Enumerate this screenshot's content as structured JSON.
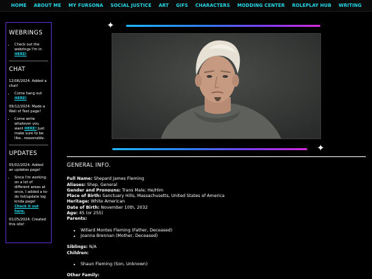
{
  "nav": [
    {
      "label": "HOME"
    },
    {
      "label": "ABOUT ME"
    },
    {
      "label": "MY FURSONA"
    },
    {
      "label": "SOCIAL JUSTICE"
    },
    {
      "label": "ART"
    },
    {
      "label": "GIFS"
    },
    {
      "label": "CHARACTERS"
    },
    {
      "label": "MODDING CENTER"
    },
    {
      "label": "ROLEPLAY HUB"
    },
    {
      "label": "WRITING"
    }
  ],
  "sidebar": {
    "webrings": {
      "title": "WEBRINGS",
      "item_text": "Check out the webrings I'm in",
      "item_link": "HERE!"
    },
    "chat": {
      "title": "CHAT",
      "entry1": "12/06/2024: Added a chat!",
      "item1_text": "Come hang out",
      "item1_link": "HERE!",
      "entry2": "09/12/2024: Made a Wall of Text page!",
      "item2_text": "Come write whatever you want",
      "item2_link": "HERE!",
      "item2_after": "Just make sure to be like.. reasonable."
    },
    "updates": {
      "title": "UPDATES",
      "entry1": "05/02/2024: Added an updates page!",
      "item_text": "Since I'm working on a lot of different areas at once, I added a to-do list/update log kinda page!",
      "item_link": "Check it out here.",
      "entry2": "01/25/2024: Created this site!"
    }
  },
  "colors": {
    "accent": "#27d7e6",
    "sidebar_border": "#5a2fd0",
    "gradient_start": "#1fb6ff",
    "gradient_end": "#d22bd6"
  },
  "info": {
    "heading": "GENERAL INFO.",
    "full_name_label": "Full Name:",
    "full_name": "Shepard James Fleming",
    "aliases_label": "Aliases:",
    "aliases": "Shep, General",
    "gender_label": "Gender and Pronouns:",
    "gender": "Trans Male; He/Him",
    "birthplace_label": "Place of Birth:",
    "birthplace": "Sanctuary Hills, Massachusetts, United States of America",
    "heritage_label": "Heritage:",
    "heritage": "White American",
    "dob_label": "Date of Birth:",
    "dob": "November 10th, 2032",
    "age_label": "Age:",
    "age": "45 (or 255)",
    "parents_label": "Parents:",
    "parents": [
      "Willard Montes Fleming (Father, Deceased)",
      "Joanna Brennan (Mother, Deceased)"
    ],
    "siblings_label": "Siblings:",
    "siblings": "N/A",
    "children_label": "Children:",
    "children": [
      "Shaun Fleming (Son, Unknown)"
    ],
    "other_label": "Other Family:"
  }
}
